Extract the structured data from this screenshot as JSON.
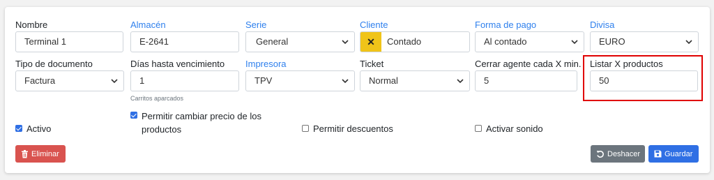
{
  "fields": {
    "nombre": {
      "label": "Nombre",
      "value": "Terminal 1"
    },
    "almacen": {
      "label": "Almacén",
      "value": "E-2641"
    },
    "serie": {
      "label": "Serie",
      "value": "General"
    },
    "cliente": {
      "label": "Cliente",
      "value": "Contado",
      "clear_icon": "x-icon"
    },
    "forma_pago": {
      "label": "Forma de pago",
      "value": "Al contado"
    },
    "divisa": {
      "label": "Divisa",
      "value": "EURO"
    },
    "tipo_documento": {
      "label": "Tipo de documento",
      "value": "Factura"
    },
    "dias_vencimiento": {
      "label": "Días hasta vencimiento",
      "value": "1",
      "hint": "Carritos aparcados"
    },
    "impresora": {
      "label": "Impresora",
      "value": "TPV"
    },
    "ticket": {
      "label": "Ticket",
      "value": "Normal"
    },
    "cerrar_agente": {
      "label": "Cerrar agente cada X min.",
      "value": "5"
    },
    "listar_productos": {
      "label": "Listar X productos",
      "value": "50"
    }
  },
  "checkboxes": {
    "activo": {
      "label": "Activo",
      "checked": true
    },
    "cambiar_precio": {
      "label_line1": "Permitir cambiar precio de los",
      "label_line2": "productos",
      "checked": true
    },
    "descuentos": {
      "label": "Permitir descuentos",
      "checked": false
    },
    "sonido": {
      "label": "Activar sonido",
      "checked": false
    }
  },
  "buttons": {
    "eliminar": "Eliminar",
    "deshacer": "Deshacer",
    "guardar": "Guardar"
  },
  "colors": {
    "link_label": "#2f80ed",
    "danger": "#d9534f",
    "secondary": "#6c757d",
    "primary": "#2f6fe4",
    "client_badge": "#f0c419",
    "highlight": "#e00000"
  }
}
